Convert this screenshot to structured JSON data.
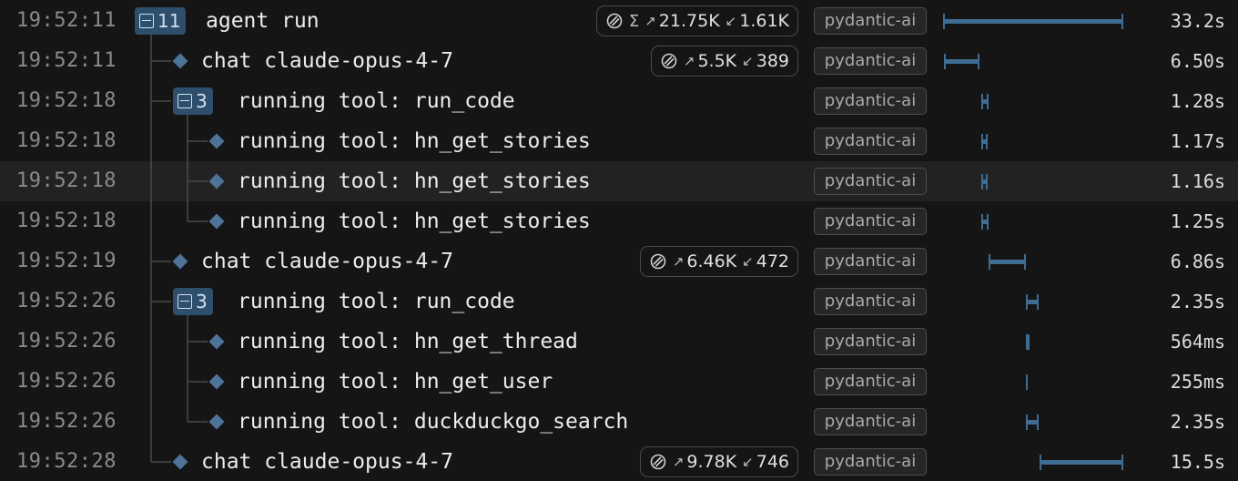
{
  "rows": [
    {
      "time": "19:52:11",
      "title": "agent run",
      "depth": 0,
      "count": "11",
      "sigma": true,
      "in": "21.75K",
      "out": "1.61K",
      "service": "pydantic-ai",
      "duration": "33.2s",
      "start": 0.0,
      "length": 33.2
    },
    {
      "time": "19:52:11",
      "title": "chat claude-opus-4-7",
      "depth": 1,
      "in": "5.5K",
      "out": "389",
      "service": "pydantic-ai",
      "duration": "6.50s",
      "start": 0.2,
      "length": 6.5
    },
    {
      "time": "19:52:18",
      "title": "running tool: run_code",
      "depth": 1,
      "count": "3",
      "service": "pydantic-ai",
      "duration": "1.28s",
      "start": 7.1,
      "length": 1.28
    },
    {
      "time": "19:52:18",
      "title": "running tool: hn_get_stories",
      "depth": 2,
      "service": "pydantic-ai",
      "duration": "1.17s",
      "start": 7.1,
      "length": 1.17
    },
    {
      "time": "19:52:18",
      "title": "running tool: hn_get_stories",
      "depth": 2,
      "service": "pydantic-ai",
      "duration": "1.16s",
      "start": 7.1,
      "length": 1.16,
      "highlight": true
    },
    {
      "time": "19:52:18",
      "title": "running tool: hn_get_stories",
      "depth": 2,
      "service": "pydantic-ai",
      "duration": "1.25s",
      "start": 7.1,
      "length": 1.25
    },
    {
      "time": "19:52:19",
      "title": "chat claude-opus-4-7",
      "depth": 1,
      "in": "6.46K",
      "out": "472",
      "service": "pydantic-ai",
      "duration": "6.86s",
      "start": 8.4,
      "length": 6.86
    },
    {
      "time": "19:52:26",
      "title": "running tool: run_code",
      "depth": 1,
      "count": "3",
      "service": "pydantic-ai",
      "duration": "2.35s",
      "start": 15.3,
      "length": 2.35
    },
    {
      "time": "19:52:26",
      "title": "running tool: hn_get_thread",
      "depth": 2,
      "service": "pydantic-ai",
      "duration": "564ms",
      "start": 15.3,
      "length": 0.564
    },
    {
      "time": "19:52:26",
      "title": "running tool: hn_get_user",
      "depth": 2,
      "service": "pydantic-ai",
      "duration": "255ms",
      "start": 15.3,
      "length": 0.255
    },
    {
      "time": "19:52:26",
      "title": "running tool: duckduckgo_search",
      "depth": 2,
      "service": "pydantic-ai",
      "duration": "2.35s",
      "start": 15.3,
      "length": 2.35
    },
    {
      "time": "19:52:28",
      "title": "chat claude-opus-4-7",
      "depth": 1,
      "in": "9.78K",
      "out": "746",
      "service": "pydantic-ai",
      "duration": "15.5s",
      "start": 17.7,
      "length": 15.5
    }
  ],
  "colors": {
    "bar": "#3f6c93",
    "count_bg": "#2e4f6b",
    "diamond": "#4d7398",
    "highlight": "#222222"
  },
  "icons": {
    "group": "collapse-square-icon",
    "span": "diamond-icon",
    "tokens": "coin-icon",
    "input": "arrow-up-right-icon",
    "output": "arrow-down-left-icon",
    "sum": "sigma-icon"
  }
}
